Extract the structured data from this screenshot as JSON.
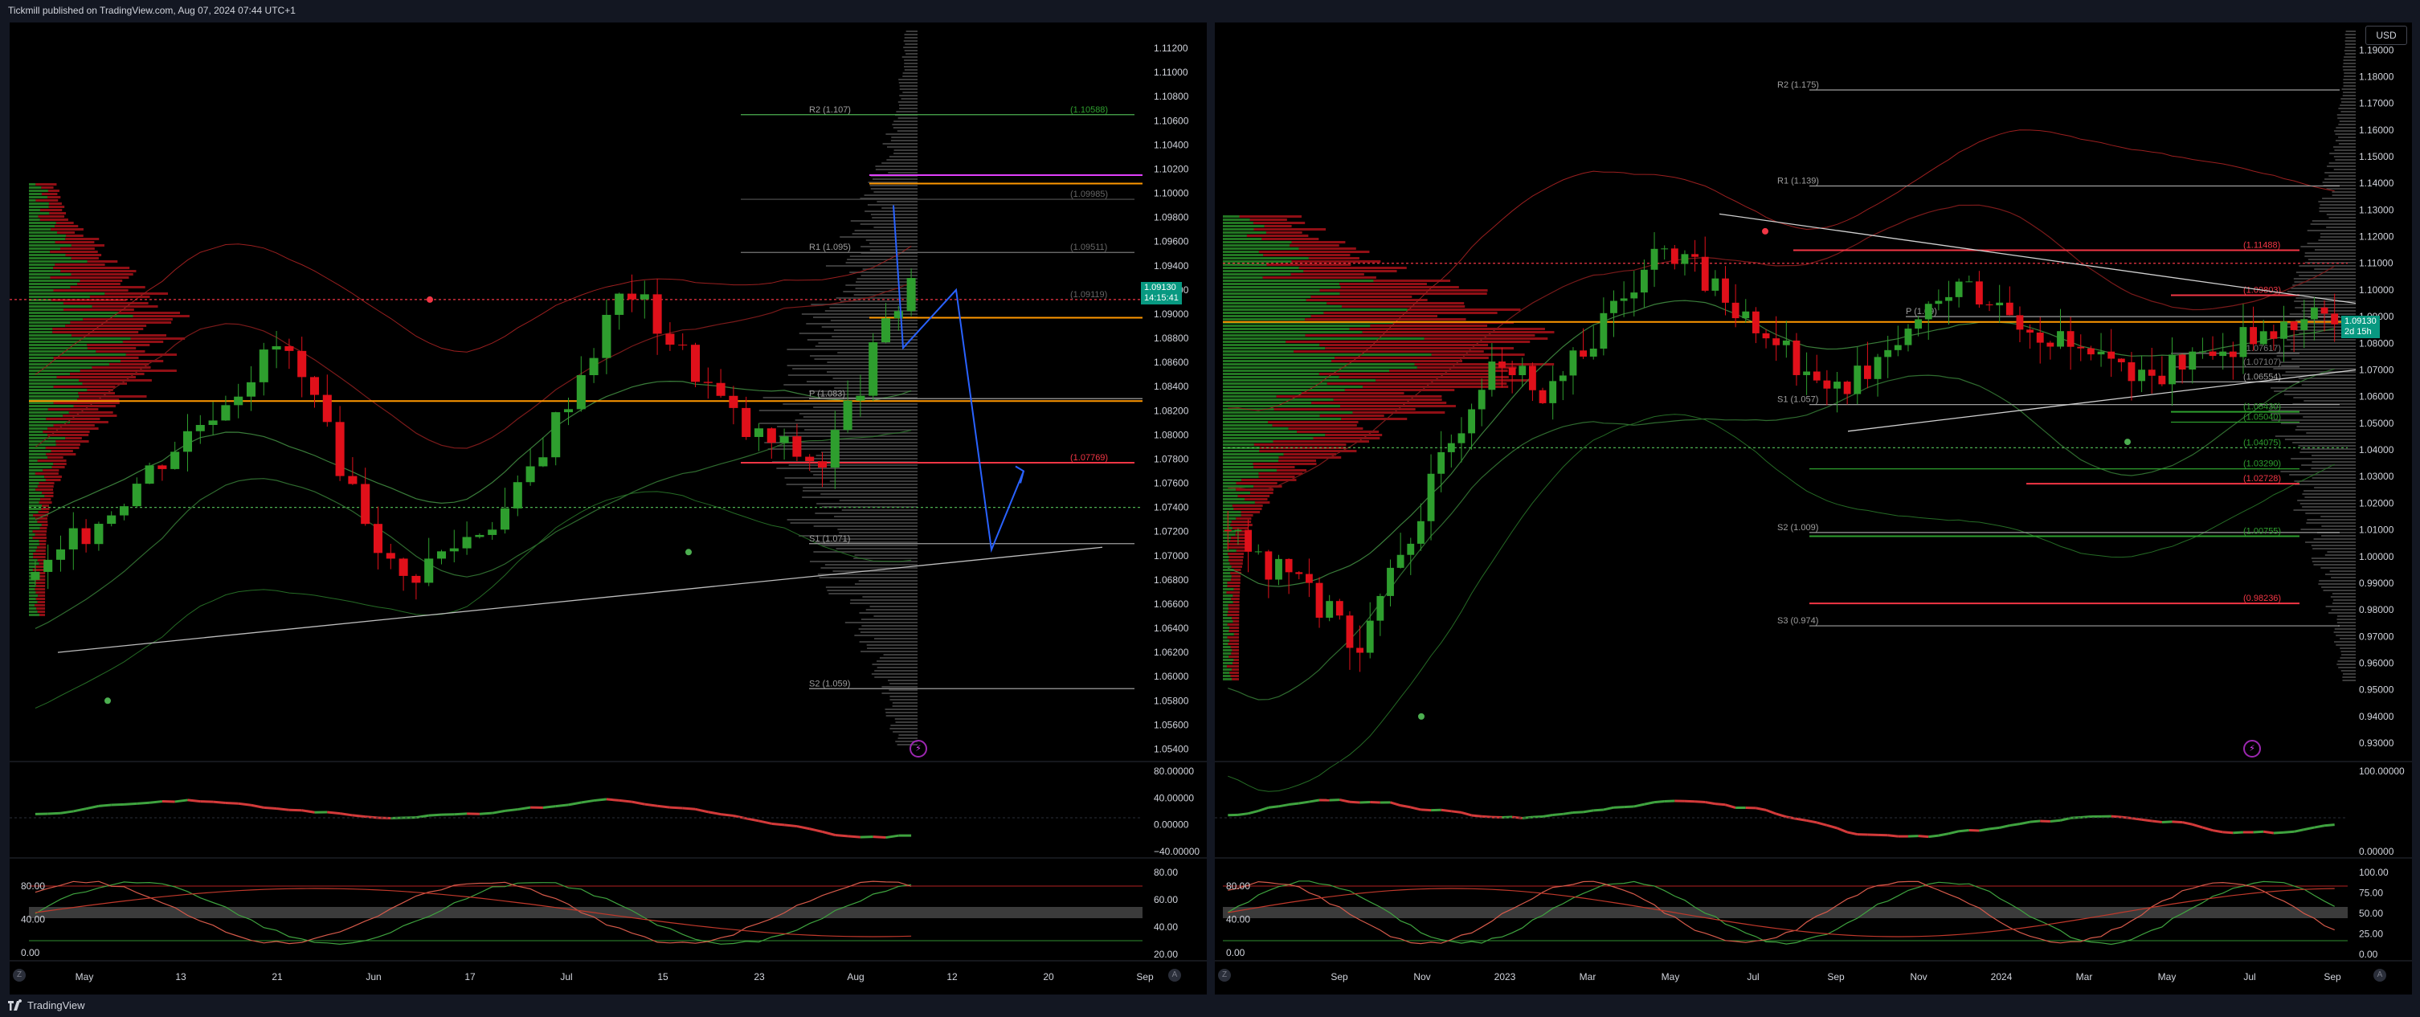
{
  "header": {
    "published": "Tickmill published on TradingView.com, Aug 07, 2024 07:44 UTC+1"
  },
  "footer": {
    "brand": "TradingView"
  },
  "colors": {
    "up": "#089981",
    "down": "#f23645",
    "candle_up": "#2e9e2e",
    "candle_down": "#e0101a"
  },
  "left_chart": {
    "price_labels": [
      "1.11200",
      "1.11000",
      "1.10800",
      "1.10600",
      "1.10400",
      "1.10200",
      "1.10000",
      "1.09800",
      "1.09600",
      "1.09400",
      "1.09200",
      "1.09000",
      "1.08800",
      "1.08600",
      "1.08400",
      "1.08200",
      "1.08000",
      "1.07800",
      "1.07600",
      "1.07400",
      "1.07200",
      "1.07000",
      "1.06800",
      "1.06600",
      "1.06400",
      "1.06200",
      "1.06000",
      "1.05800",
      "1.05600",
      "1.05400"
    ],
    "current_price": "1.09130",
    "countdown": "14:15:41",
    "pivot_labels": {
      "r2": "R2 (1.107)",
      "r1": "R1 (1.095)",
      "p": "P (1.083)",
      "s1": "S1 (1.071)",
      "s2": "S2 (1.059)"
    },
    "level_labels": {
      "l1": "(1.10588)",
      "l2": "(1.09985)",
      "l3": "(1.09511)",
      "l4": "(1.09119)",
      "l5": "(1.07769)"
    },
    "time_labels": [
      "May",
      "13",
      "21",
      "Jun",
      "17",
      "Jul",
      "15",
      "23",
      "Aug",
      "12",
      "20",
      "Sep"
    ],
    "osc1_labels": [
      "80.00000",
      "40.00000",
      "0.00000",
      "−40.00000"
    ],
    "osc2_left_labels": [
      "80.00",
      "40.00",
      "0.00"
    ],
    "osc2_right_labels": [
      "80.00",
      "60.00",
      "40.00",
      "20.00"
    ]
  },
  "right_chart": {
    "currency": "USD",
    "price_labels": [
      "1.19000",
      "1.18000",
      "1.17000",
      "1.16000",
      "1.15000",
      "1.14000",
      "1.13000",
      "1.12000",
      "1.11000",
      "1.10000",
      "1.09000",
      "1.08000",
      "1.07000",
      "1.06000",
      "1.05000",
      "1.04000",
      "1.03000",
      "1.02000",
      "1.01000",
      "1.00000",
      "0.99000",
      "0.98000",
      "0.97000",
      "0.96000",
      "0.95000",
      "0.94000",
      "0.93000"
    ],
    "current_price": "1.09130",
    "countdown": "2d 15h",
    "pivot_labels": {
      "r2": "R2 (1.175)",
      "r1": "R1 (1.139)",
      "p": "P (1.09)",
      "s1": "S1 (1.057)",
      "s2": "S2 (1.009)",
      "s3": "S3 (0.974)"
    },
    "level_labels": {
      "l1": "(1.11488)",
      "l2": "(1.09803)",
      "l3": "(1.07617)",
      "l4": "(1.07107)",
      "l5": "(1.06554)",
      "l6": "(1.05430)",
      "l7": "(1.05040)",
      "l8": "(1.04075)",
      "l9": "(1.03290)",
      "l10": "(1.02728)",
      "l11": "(1.00755)",
      "l12": "(0.98236)"
    },
    "time_labels": [
      "Sep",
      "Nov",
      "2023",
      "Mar",
      "May",
      "Jul",
      "Sep",
      "Nov",
      "2024",
      "Mar",
      "May",
      "Jul",
      "Sep"
    ],
    "osc1_labels": [
      "100.00000",
      "0.00000"
    ],
    "osc2_left_labels": [
      "80.00",
      "40.00",
      "0.00"
    ],
    "osc2_right_labels": [
      "100.00",
      "75.00",
      "50.00",
      "25.00",
      "0.00"
    ]
  }
}
